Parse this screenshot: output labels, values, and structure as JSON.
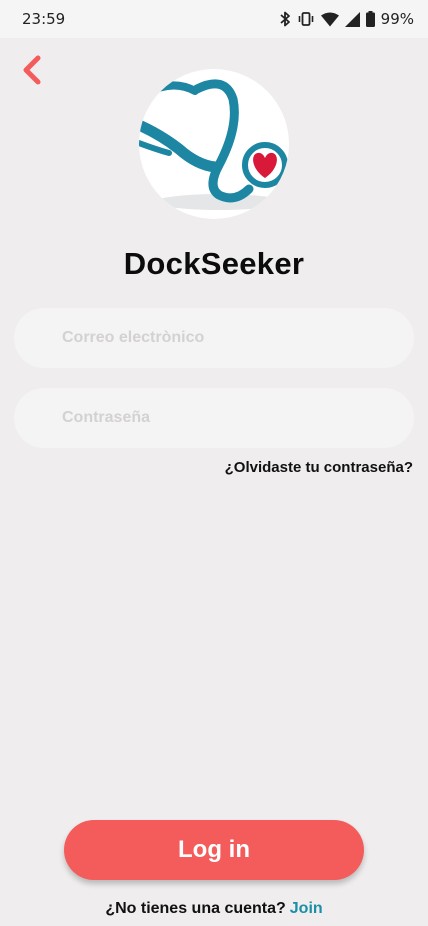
{
  "status_bar": {
    "time": "23:59",
    "battery": "99%",
    "icons": [
      "bluetooth-icon",
      "vibrate-icon",
      "wifi-icon",
      "signal-icon",
      "battery-icon"
    ]
  },
  "header": {
    "back_icon": "chevron-left-icon"
  },
  "brand": {
    "logo_icon": "stethoscope-heart-icon",
    "title": "DockSeeker"
  },
  "form": {
    "email_placeholder": "Correo electrònico",
    "email_value": "",
    "password_placeholder": "Contraseña",
    "password_value": "",
    "forgot_password": "¿Olvidaste tu contraseña?"
  },
  "actions": {
    "login_label": "Log in",
    "no_account_text": "¿No tienes una cuenta?",
    "join_label": "Join"
  },
  "colors": {
    "accent": "#f45b5b",
    "link": "#1a8fa6",
    "background": "#efedee",
    "logo_teal": "#1c86a3",
    "heart": "#d8193a"
  }
}
